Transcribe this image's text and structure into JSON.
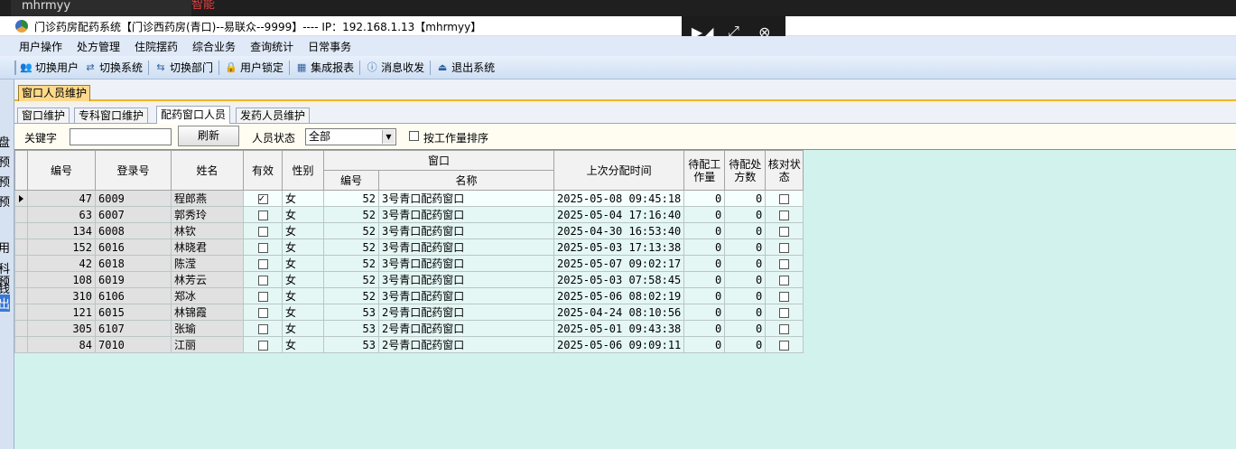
{
  "browser": {
    "tab_title": "mhrmyy",
    "tab_second": "智能"
  },
  "titlebar": {
    "title": "门诊药房配药系统【门诊西药房(青口)--易联众--9999】---- IP：192.168.1.13【mhrmyy】"
  },
  "menu": [
    "用户操作",
    "处方管理",
    "住院摆药",
    "综合业务",
    "查询统计",
    "日常事务"
  ],
  "toolbar": [
    {
      "label": "切换用户",
      "icon": "users-icon"
    },
    {
      "label": "切换系统",
      "icon": "switch-system-icon"
    },
    {
      "label": "切换部门",
      "icon": "switch-department-icon"
    },
    {
      "label": "用户锁定",
      "icon": "user-lock-icon"
    },
    {
      "label": "集成报表",
      "icon": "report-icon"
    },
    {
      "label": "消息收发",
      "icon": "info-icon"
    },
    {
      "label": "退出系统",
      "icon": "exit-icon"
    }
  ],
  "left_stub": [
    "盘",
    "预",
    "预",
    "预",
    "用",
    "科",
    "钱",
    "预",
    "出"
  ],
  "doc_tab": "窗口人员维护",
  "inner_tabs": [
    {
      "label": "窗口维护",
      "active": false
    },
    {
      "label": "专科窗口维护",
      "active": false
    },
    {
      "label": "配药窗口人员",
      "active": true
    },
    {
      "label": "发药人员维护",
      "active": false
    }
  ],
  "filter": {
    "keyword_label": "关键字",
    "keyword_value": "",
    "refresh_label": "刷新",
    "status_label": "人员状态",
    "status_value": "全部",
    "sort_label": "按工作量排序",
    "sort_checked": false
  },
  "grid": {
    "headers": {
      "id": "编号",
      "login": "登录号",
      "name": "姓名",
      "valid": "有效",
      "gender": "性别",
      "window_group": "窗口",
      "window_id": "编号",
      "window_name": "名称",
      "last_time": "上次分配时间",
      "pending_work": "待配工作量",
      "pending_rx": "待配处方数",
      "check_status": "核对状态"
    },
    "rows": [
      {
        "id": "47",
        "login": "6009",
        "name": "程郎燕",
        "valid": true,
        "gender": "女",
        "window_id": "52",
        "window_name": "3号青口配药窗口",
        "last_time": "2025-05-08 09:45:18",
        "pending_work": "0",
        "pending_rx": "0",
        "check": false
      },
      {
        "id": "63",
        "login": "6007",
        "name": "郭秀玲",
        "valid": false,
        "gender": "女",
        "window_id": "52",
        "window_name": "3号青口配药窗口",
        "last_time": "2025-05-04 17:16:40",
        "pending_work": "0",
        "pending_rx": "0",
        "check": false
      },
      {
        "id": "134",
        "login": "6008",
        "name": "林钦",
        "valid": false,
        "gender": "女",
        "window_id": "52",
        "window_name": "3号青口配药窗口",
        "last_time": "2025-04-30 16:53:40",
        "pending_work": "0",
        "pending_rx": "0",
        "check": false
      },
      {
        "id": "152",
        "login": "6016",
        "name": "林晓君",
        "valid": false,
        "gender": "女",
        "window_id": "52",
        "window_name": "3号青口配药窗口",
        "last_time": "2025-05-03 17:13:38",
        "pending_work": "0",
        "pending_rx": "0",
        "check": false
      },
      {
        "id": "42",
        "login": "6018",
        "name": "陈滢",
        "valid": false,
        "gender": "女",
        "window_id": "52",
        "window_name": "3号青口配药窗口",
        "last_time": "2025-05-07 09:02:17",
        "pending_work": "0",
        "pending_rx": "0",
        "check": false
      },
      {
        "id": "108",
        "login": "6019",
        "name": "林芳云",
        "valid": false,
        "gender": "女",
        "window_id": "52",
        "window_name": "3号青口配药窗口",
        "last_time": "2025-05-03 07:58:45",
        "pending_work": "0",
        "pending_rx": "0",
        "check": false
      },
      {
        "id": "310",
        "login": "6106",
        "name": "郑冰",
        "valid": false,
        "gender": "女",
        "window_id": "52",
        "window_name": "3号青口配药窗口",
        "last_time": "2025-05-06 08:02:19",
        "pending_work": "0",
        "pending_rx": "0",
        "check": false
      },
      {
        "id": "121",
        "login": "6015",
        "name": "林锦霞",
        "valid": false,
        "gender": "女",
        "window_id": "53",
        "window_name": "2号青口配药窗口",
        "last_time": "2025-04-24 08:10:56",
        "pending_work": "0",
        "pending_rx": "0",
        "check": false
      },
      {
        "id": "305",
        "login": "6107",
        "name": "张瑜",
        "valid": false,
        "gender": "女",
        "window_id": "53",
        "window_name": "2号青口配药窗口",
        "last_time": "2025-05-01 09:43:38",
        "pending_work": "0",
        "pending_rx": "0",
        "check": false
      },
      {
        "id": "84",
        "login": "7010",
        "name": "江丽",
        "valid": false,
        "gender": "女",
        "window_id": "53",
        "window_name": "2号青口配药窗口",
        "last_time": "2025-05-06 09:09:11",
        "pending_work": "0",
        "pending_rx": "0",
        "check": false
      }
    ]
  }
}
